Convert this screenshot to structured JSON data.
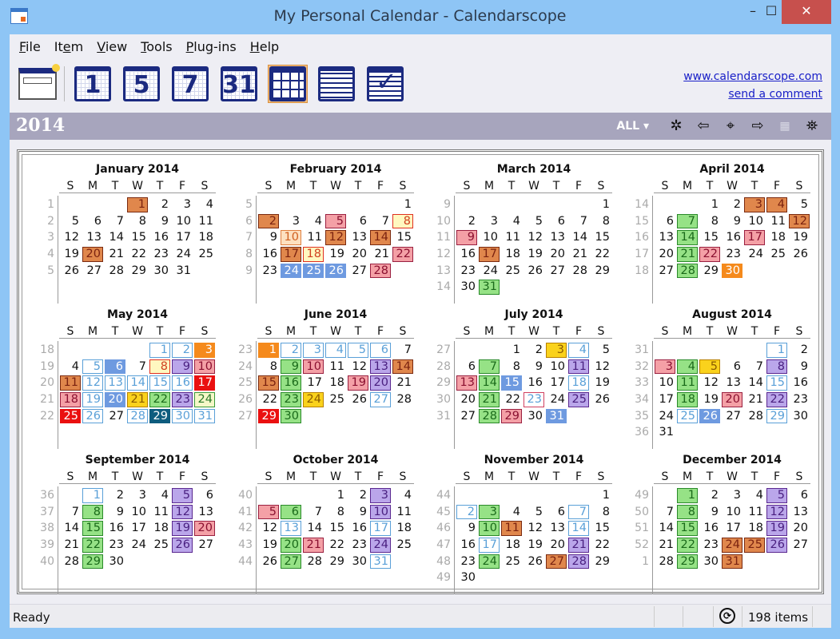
{
  "window": {
    "title": "My Personal Calendar - Calendarscope",
    "minimize": "–",
    "maximize": "☐",
    "close": "✕"
  },
  "menu": [
    {
      "label": "File",
      "accel": "F",
      "rest": "ile"
    },
    {
      "label": "Item",
      "pre": "It",
      "accel": "e",
      "rest": "m"
    },
    {
      "label": "View",
      "accel": "V",
      "rest": "iew"
    },
    {
      "label": "Tools",
      "accel": "T",
      "rest": "ools"
    },
    {
      "label": "Plug-ins",
      "accel": "P",
      "rest": "lug-ins"
    },
    {
      "label": "Help",
      "accel": "H",
      "rest": "elp"
    }
  ],
  "toolbar": {
    "new_item": "new-item",
    "day": "1",
    "workweek": "5",
    "week": "7",
    "month": "31",
    "year": "year-view",
    "list": "list-view",
    "tasks": "tasks-view",
    "active": "year"
  },
  "links": {
    "website": "www.calendarscope.com",
    "comment": "send a comment"
  },
  "yearbar": {
    "year": "2014",
    "filter": "ALL ▾",
    "icons": [
      "gear-icon",
      "prev-arrow-icon",
      "today-target-icon",
      "next-arrow-icon",
      "grid-icon",
      "binoculars-icon"
    ]
  },
  "dow": [
    "S",
    "M",
    "T",
    "W",
    "T",
    "F",
    "S"
  ],
  "months": [
    {
      "title": "January 2014",
      "start": 3,
      "days": 31,
      "weeks": [
        "1",
        "2",
        "3",
        "4",
        "5"
      ],
      "events": {
        "1": "o",
        "20": "o"
      }
    },
    {
      "title": "February 2014",
      "start": 6,
      "days": 28,
      "weeks": [
        "5",
        "6",
        "7",
        "8",
        "9"
      ],
      "events": {
        "2": "o",
        "5": "pk",
        "8": "y8",
        "10": "lo",
        "12": "o",
        "14": "o",
        "17": "o",
        "18": "y8",
        "22": "pk",
        "24": "bl",
        "25": "bl",
        "26": "bl",
        "28": "pk"
      }
    },
    {
      "title": "March 2014",
      "start": 6,
      "days": 31,
      "weeks": [
        "9",
        "10",
        "11",
        "12",
        "13",
        "14"
      ],
      "events": {
        "9": "pk",
        "17": "o",
        "31": "g"
      }
    },
    {
      "title": "April 2014",
      "start": 2,
      "days": 30,
      "weeks": [
        "14",
        "15",
        "16",
        "17",
        "18"
      ],
      "events": {
        "3": "o",
        "4": "o",
        "7": "g",
        "12": "o",
        "14": "g",
        "17": "pk",
        "21": "g",
        "22": "pk",
        "28": "g",
        "30": "or"
      }
    },
    {
      "title": "May 2014",
      "start": 4,
      "days": 31,
      "weeks": [
        "18",
        "19",
        "20",
        "21",
        "22"
      ],
      "events": {
        "1": "bo",
        "2": "bo",
        "3": "or",
        "5": "bo",
        "6": "bl",
        "8": "y8",
        "9": "pu",
        "10": "pk",
        "11": "o",
        "12": "bo",
        "13": "bo",
        "14": "bo",
        "15": "bo",
        "16": "bo",
        "17": "rd",
        "18": "pk",
        "19": "bo",
        "20": "bl",
        "21": "yl",
        "22": "g",
        "23": "pu",
        "24": "ly",
        "25": "rd",
        "26": "bo",
        "28": "bo",
        "29": "tl",
        "30": "bo",
        "31": "bo"
      }
    },
    {
      "title": "June 2014",
      "start": 0,
      "days": 30,
      "weeks": [
        "23",
        "24",
        "25",
        "26",
        "27"
      ],
      "events": {
        "1": "or",
        "2": "bo",
        "3": "bo",
        "4": "bo",
        "5": "bo",
        "6": "bo",
        "9": "g",
        "10": "pk",
        "13": "pu",
        "14": "o",
        "15": "o",
        "16": "g",
        "19": "pk",
        "20": "pu",
        "23": "g",
        "24": "yl",
        "27": "bo",
        "29": "rd",
        "30": "g"
      }
    },
    {
      "title": "July 2014",
      "start": 2,
      "days": 31,
      "weeks": [
        "27",
        "28",
        "29",
        "30",
        "31"
      ],
      "events": {
        "3": "yl",
        "4": "bo",
        "7": "g",
        "11": "pu",
        "13": "pk",
        "14": "g",
        "15": "bl",
        "18": "bo",
        "21": "g",
        "23": "pko",
        "25": "pu",
        "28": "g",
        "29": "pk",
        "31": "bl"
      }
    },
    {
      "title": "August 2014",
      "start": 5,
      "days": 31,
      "weeks": [
        "31",
        "32",
        "33",
        "34",
        "35",
        "36"
      ],
      "events": {
        "1": "bo",
        "3": "pk",
        "4": "g",
        "5": "yl",
        "8": "pu",
        "11": "g",
        "15": "bo",
        "18": "g",
        "20": "pk",
        "22": "pu",
        "25": "bo",
        "26": "bl",
        "29": "bo"
      }
    },
    {
      "title": "September 2014",
      "start": 1,
      "days": 30,
      "weeks": [
        "36",
        "37",
        "38",
        "39",
        "40"
      ],
      "events": {
        "1": "bo",
        "5": "pu",
        "8": "g",
        "12": "pu",
        "15": "g",
        "19": "pu",
        "20": "pk",
        "22": "g",
        "26": "pu",
        "29": "g"
      }
    },
    {
      "title": "October 2014",
      "start": 3,
      "days": 31,
      "weeks": [
        "40",
        "41",
        "42",
        "43",
        "44"
      ],
      "events": {
        "3": "pu",
        "5": "pk",
        "6": "g",
        "10": "pu",
        "13": "bo",
        "17": "bo",
        "20": "g",
        "21": "pk",
        "24": "pu",
        "27": "g",
        "31": "bo"
      }
    },
    {
      "title": "November 2014",
      "start": 6,
      "days": 30,
      "weeks": [
        "44",
        "45",
        "46",
        "47",
        "48",
        "49"
      ],
      "events": {
        "2": "bo",
        "3": "g",
        "7": "bo",
        "10": "g",
        "11": "o",
        "14": "bo",
        "17": "bo",
        "21": "pu",
        "24": "g",
        "27": "o",
        "28": "pu"
      }
    },
    {
      "title": "December 2014",
      "start": 1,
      "days": 31,
      "weeks": [
        "49",
        "50",
        "51",
        "52",
        "1"
      ],
      "events": {
        "1": "g",
        "5": "pu",
        "8": "g",
        "12": "pu",
        "15": "g",
        "19": "pu",
        "22": "g",
        "24": "o",
        "25": "o",
        "26": "pu",
        "29": "g",
        "31": "o"
      }
    }
  ],
  "status": {
    "text": "Ready",
    "items": "198 items",
    "sync_icon": "sync-icon"
  },
  "colors": {
    "titlebar": "#8ec5f5",
    "yearbar": "#a7a5bd",
    "close": "#c7504d",
    "link": "#1a20c8",
    "toolbar_icon": "#1b2a80"
  }
}
